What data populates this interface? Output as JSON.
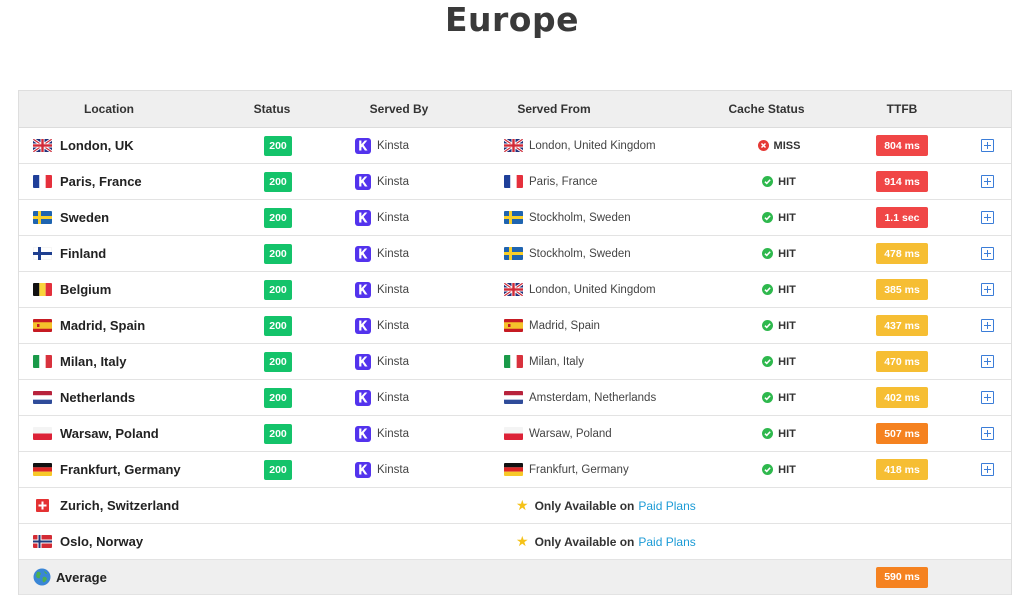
{
  "page": {
    "title": "Europe"
  },
  "table": {
    "headers": {
      "location": "Location",
      "status": "Status",
      "served_by": "Served By",
      "served_from": "Served From",
      "cache_status": "Cache Status",
      "ttfb": "TTFB"
    },
    "rows": [
      {
        "location": "London, UK",
        "flag": "uk",
        "status": "200",
        "served_by": "Kinsta",
        "served_from": "London, United Kingdom",
        "from_flag": "uk",
        "cache": "MISS",
        "cache_icon": "x-circle-icon",
        "ttfb": "804 ms",
        "ttfb_color": "#f04646"
      },
      {
        "location": "Paris, France",
        "flag": "fr",
        "status": "200",
        "served_by": "Kinsta",
        "served_from": "Paris, France",
        "from_flag": "fr",
        "cache": "HIT",
        "cache_icon": "check-circle-icon",
        "ttfb": "914 ms",
        "ttfb_color": "#f04646"
      },
      {
        "location": "Sweden",
        "flag": "se",
        "status": "200",
        "served_by": "Kinsta",
        "served_from": "Stockholm, Sweden",
        "from_flag": "se",
        "cache": "HIT",
        "cache_icon": "check-circle-icon",
        "ttfb": "1.1 sec",
        "ttfb_color": "#f04646"
      },
      {
        "location": "Finland",
        "flag": "fi",
        "status": "200",
        "served_by": "Kinsta",
        "served_from": "Stockholm, Sweden",
        "from_flag": "se",
        "cache": "HIT",
        "cache_icon": "check-circle-icon",
        "ttfb": "478 ms",
        "ttfb_color": "#f6be33"
      },
      {
        "location": "Belgium",
        "flag": "be",
        "status": "200",
        "served_by": "Kinsta",
        "served_from": "London, United Kingdom",
        "from_flag": "uk",
        "cache": "HIT",
        "cache_icon": "check-circle-icon",
        "ttfb": "385 ms",
        "ttfb_color": "#f6be33"
      },
      {
        "location": "Madrid, Spain",
        "flag": "es",
        "status": "200",
        "served_by": "Kinsta",
        "served_from": "Madrid, Spain",
        "from_flag": "es",
        "cache": "HIT",
        "cache_icon": "check-circle-icon",
        "ttfb": "437 ms",
        "ttfb_color": "#f6be33"
      },
      {
        "location": "Milan, Italy",
        "flag": "it",
        "status": "200",
        "served_by": "Kinsta",
        "served_from": "Milan, Italy",
        "from_flag": "it",
        "cache": "HIT",
        "cache_icon": "check-circle-icon",
        "ttfb": "470 ms",
        "ttfb_color": "#f6be33"
      },
      {
        "location": "Netherlands",
        "flag": "nl",
        "status": "200",
        "served_by": "Kinsta",
        "served_from": "Amsterdam, Netherlands",
        "from_flag": "nl",
        "cache": "HIT",
        "cache_icon": "check-circle-icon",
        "ttfb": "402 ms",
        "ttfb_color": "#f6be33"
      },
      {
        "location": "Warsaw, Poland",
        "flag": "pl",
        "status": "200",
        "served_by": "Kinsta",
        "served_from": "Warsaw, Poland",
        "from_flag": "pl",
        "cache": "HIT",
        "cache_icon": "check-circle-icon",
        "ttfb": "507 ms",
        "ttfb_color": "#f58220"
      },
      {
        "location": "Frankfurt, Germany",
        "flag": "de",
        "status": "200",
        "served_by": "Kinsta",
        "served_from": "Frankfurt, Germany",
        "from_flag": "de",
        "cache": "HIT",
        "cache_icon": "check-circle-icon",
        "ttfb": "418 ms",
        "ttfb_color": "#f6be33"
      }
    ],
    "unavailable_rows": [
      {
        "location": "Zurich, Switzerland",
        "flag": "ch",
        "text": "Only Available on",
        "link": "Paid Plans"
      },
      {
        "location": "Oslo, Norway",
        "flag": "no",
        "text": "Only Available on",
        "link": "Paid Plans"
      }
    ],
    "average": {
      "label": "Average",
      "icon": "globe-icon",
      "ttfb": "590 ms",
      "ttfb_color": "#f58220"
    }
  },
  "colors": {
    "status_ok": "#14c36a",
    "kinsta_brand": "#5333ed",
    "cache_miss": "#e53935",
    "cache_hit": "#2eb84d",
    "link": "#1c9bd6",
    "star": "#f5c218"
  }
}
